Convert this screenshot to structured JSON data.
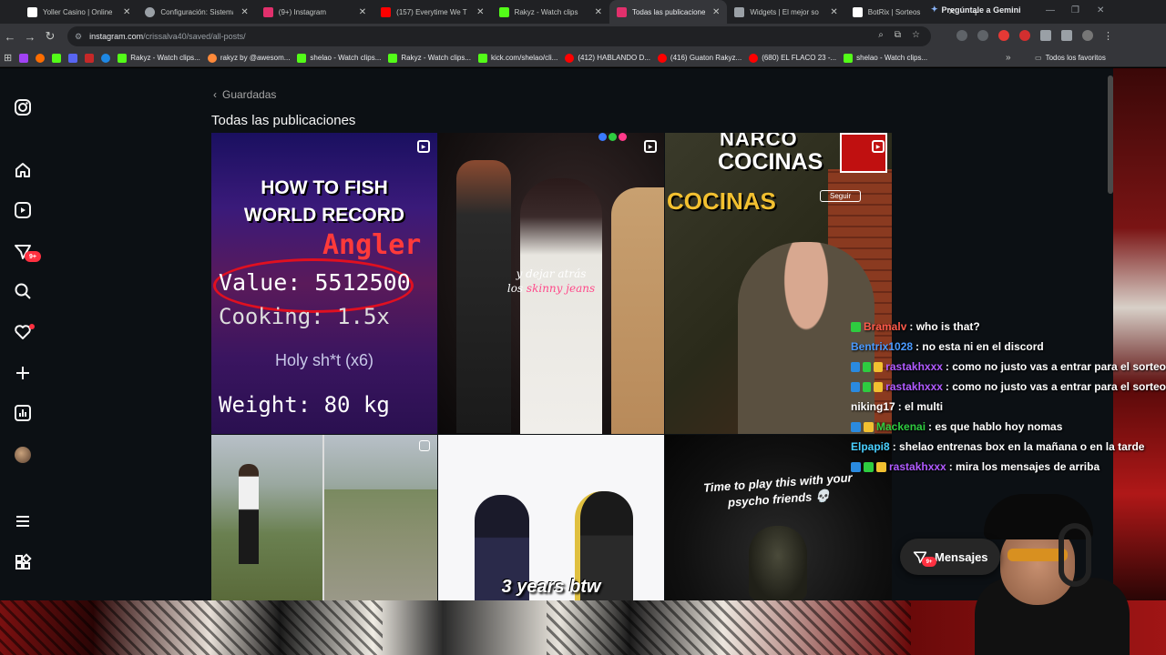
{
  "browser": {
    "tabs": [
      {
        "title": "Yoller Casino | Online",
        "color": "#ffffff"
      },
      {
        "title": "Configuración: Sistema",
        "color": "#9aa0a6"
      },
      {
        "title": "(9+) Instagram",
        "color": "#e1306c"
      },
      {
        "title": "(157) Everytime We T",
        "color": "#ff0000"
      },
      {
        "title": "Rakyz - Watch clips",
        "color": "#53fc18"
      },
      {
        "title": "Todas las publicaciones",
        "color": "#e1306c",
        "active": true
      },
      {
        "title": "Widgets | El mejor so",
        "color": "#9aa0a6"
      },
      {
        "title": "BotRix | Sorteos",
        "color": "#ffffff"
      }
    ],
    "gemini_label": "Pregúntale a Gemini",
    "url_host": "instagram.com",
    "url_path": "/crissalva40/saved/all-posts/",
    "bookmarks": [
      {
        "label": "Rakyz - Watch clips...",
        "color": "#53fc18"
      },
      {
        "label": "rakyz by @awesom...",
        "color": "#ff8a3a"
      },
      {
        "label": "shelao - Watch clips...",
        "color": "#53fc18"
      },
      {
        "label": "Rakyz - Watch clips...",
        "color": "#53fc18"
      },
      {
        "label": "kick.com/shelao/cli...",
        "color": "#53fc18"
      },
      {
        "label": "(412) HABLANDO D...",
        "color": "#ff0000"
      },
      {
        "label": "(416) Guaton Rakyz...",
        "color": "#ff0000"
      },
      {
        "label": "(680) EL FLACO 23 -...",
        "color": "#ff0000"
      },
      {
        "label": "shelao - Watch clips...",
        "color": "#53fc18"
      }
    ],
    "all_bookmarks_label": "Todos los favoritos"
  },
  "instagram": {
    "back_label": "Guardadas",
    "page_title": "Todas las publicaciones",
    "messages_badge": "9+",
    "posts": {
      "p1": {
        "title_line1": "HOW TO FISH",
        "title_line2": "WORLD RECORD",
        "angler": "Angler",
        "value": "Value: 5512500",
        "cooking": "Cooking: 1.5x",
        "holy": "Holy sh*t (x6)",
        "weight": "Weight: 80 kg"
      },
      "p2": {
        "caption1": "y dejar atrás",
        "caption2_pre": "los ",
        "caption2_pink": "skinny jeans"
      },
      "p3": {
        "header1": "NARCO",
        "header2": "COCINAS",
        "side_title": "COCINAS",
        "follow": "Seguir"
      },
      "p5": {
        "caption": "3 years btw"
      },
      "p6": {
        "caption_line1": "Time to play this with your",
        "caption_line2": "psycho friends 💀"
      }
    },
    "mensajes_label": "Mensajes",
    "mensajes_badge": "9+"
  },
  "chat": [
    {
      "user": "Bramalv",
      "user_color": "#ff5a4a",
      "message": ": who is that?",
      "badges": [
        "#2ecc40"
      ]
    },
    {
      "user": "Bentrix1028",
      "user_color": "#4a9aff",
      "message": ": no esta ni en el discord",
      "badges": []
    },
    {
      "user": "rastakhxxx",
      "user_color": "#b05aff",
      "message": ": como no justo vas a entrar para el sorteo",
      "badges": [
        "#2a8adf",
        "#2ecc40",
        "#f2c030"
      ]
    },
    {
      "user": "rastakhxxx",
      "user_color": "#b05aff",
      "message": ": como no justo vas a entrar para el sorteo",
      "badges": [
        "#2a8adf",
        "#2ecc40",
        "#f2c030"
      ]
    },
    {
      "user": "niking17",
      "user_color": "#ffffff",
      "message": ": el multi",
      "badges": []
    },
    {
      "user": "Mackenai",
      "user_color": "#2ecc40",
      "message": ": es que hablo hoy nomas",
      "badges": [
        "#2a8adf",
        "#f2c030"
      ]
    },
    {
      "user": "Elpapi8",
      "user_color": "#4ad0ff",
      "message": ": shelao entrenas box en la mañana o en la tarde",
      "badges": []
    },
    {
      "user": "rastakhxxx",
      "user_color": "#b05aff",
      "message": ": mira los mensajes de arriba",
      "badges": [
        "#2a8adf",
        "#2ecc40",
        "#f2c030"
      ]
    }
  ]
}
